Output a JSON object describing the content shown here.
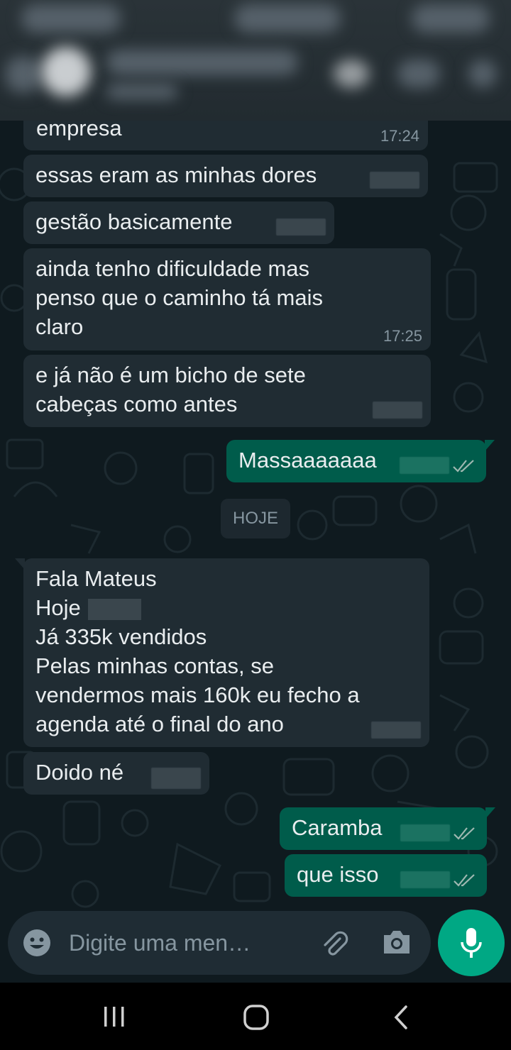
{
  "chat": {
    "messages": [
      {
        "id": "m1",
        "direction": "in",
        "text": "empresa",
        "time": "17:24"
      },
      {
        "id": "m2",
        "direction": "in",
        "text": "essas eram as minhas dores"
      },
      {
        "id": "m3",
        "direction": "in",
        "text": "gestão basicamente"
      },
      {
        "id": "m4",
        "direction": "in",
        "text": "ainda tenho dificuldade mas\npenso que o caminho tá mais\nclaro",
        "time": "17:25"
      },
      {
        "id": "m5",
        "direction": "in",
        "text": "e já não é um bicho de sete\ncabeças como antes"
      },
      {
        "id": "m6",
        "direction": "out",
        "text": "Massaaaaaaa",
        "status": "read"
      },
      {
        "id": "m7",
        "direction": "in",
        "line1": "Fala Mateus",
        "line2": "Hoje",
        "rest": "Já 335k vendidos\nPelas minhas contas, se\nvendermos mais 160k eu fecho a\nagenda até o final do ano"
      },
      {
        "id": "m8",
        "direction": "in",
        "text": "Doido né"
      },
      {
        "id": "m9",
        "direction": "out",
        "text": "Caramba",
        "status": "read"
      },
      {
        "id": "m10",
        "direction": "out",
        "text": "que isso",
        "status": "read"
      }
    ],
    "date_divider": "HOJE"
  },
  "composer": {
    "placeholder": "Digite uma men…",
    "icons": [
      "emoji-icon",
      "attach-icon",
      "camera-icon",
      "mic-icon"
    ]
  },
  "colors": {
    "incoming_bubble": "#202c33",
    "outgoing_bubble": "#005c4b",
    "accent": "#00a884",
    "text": "#e9edef",
    "meta": "#8696a0"
  },
  "navbar": {
    "icons": [
      "recent-apps-icon",
      "home-icon",
      "back-icon"
    ]
  }
}
